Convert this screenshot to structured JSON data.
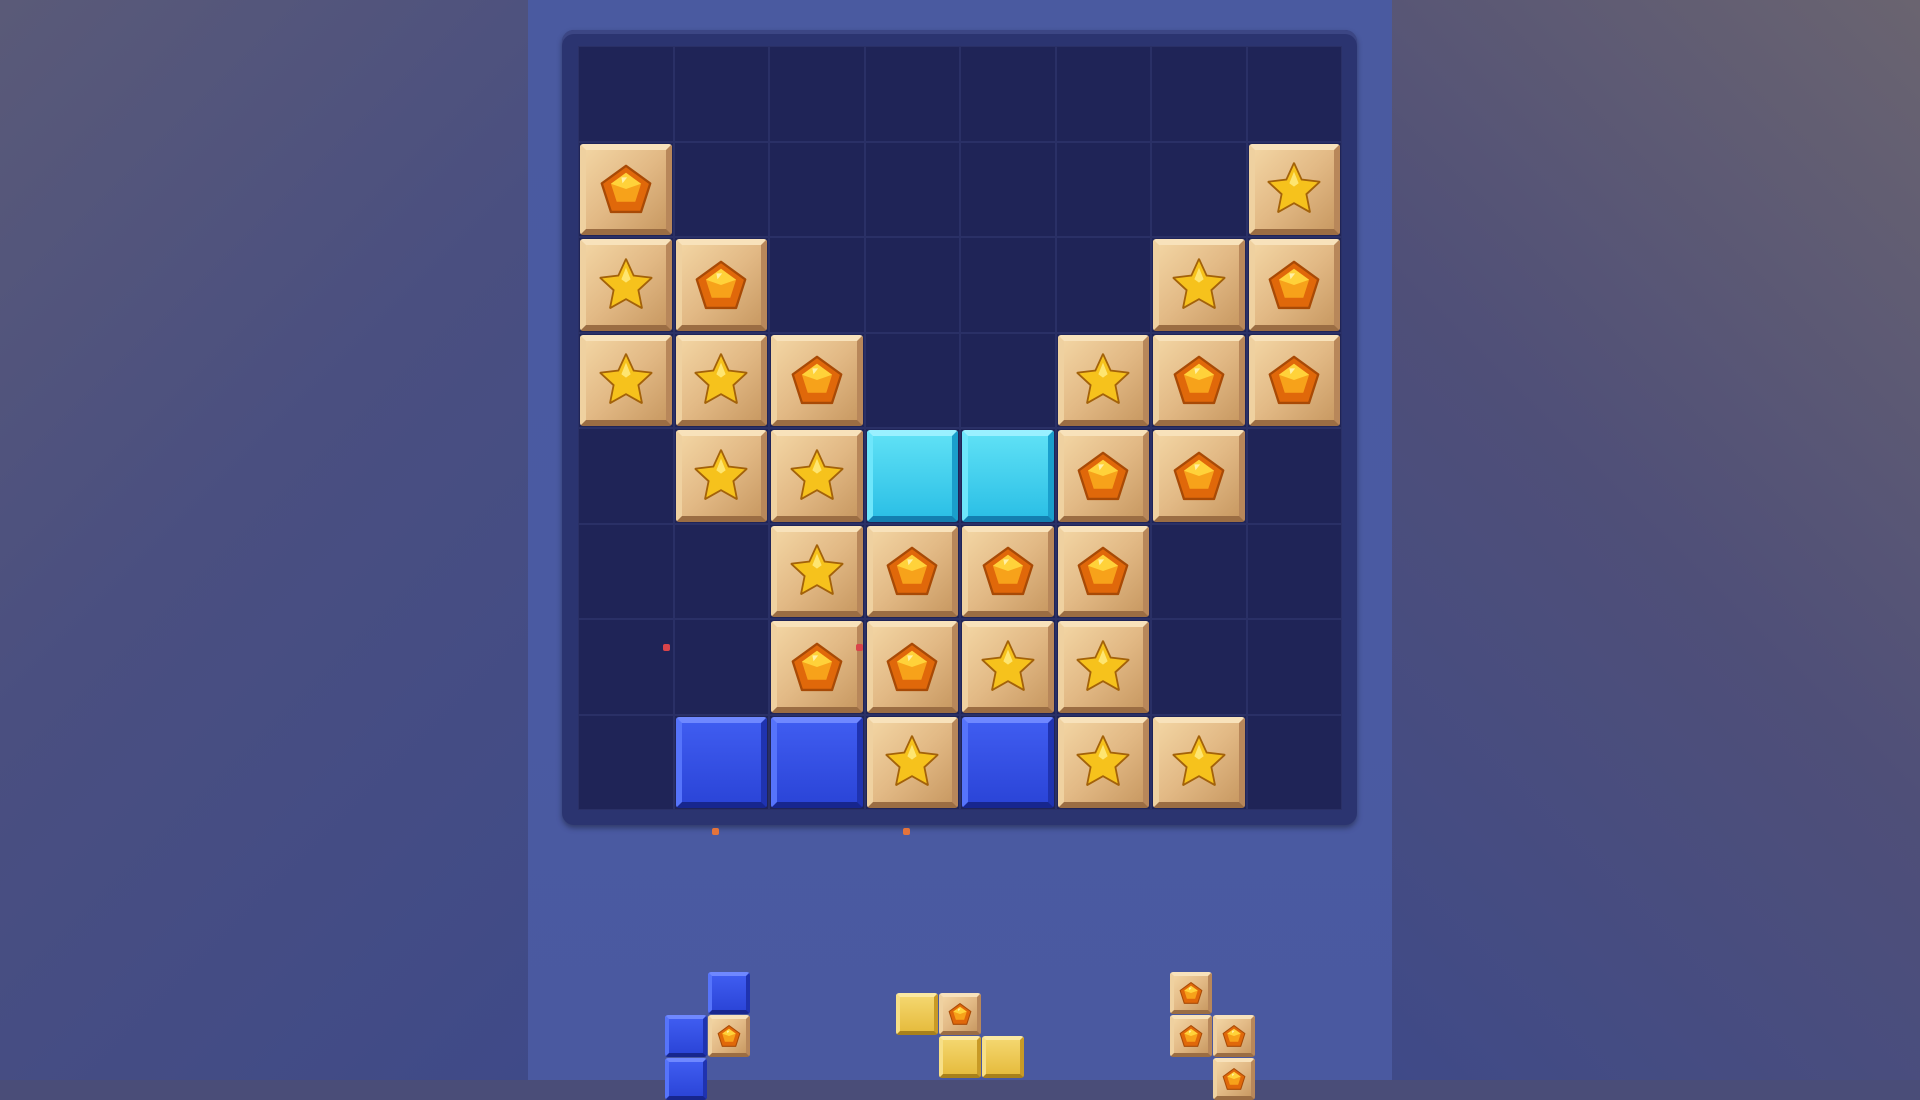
{
  "game": {
    "title": "",
    "board": {
      "rows": 8,
      "cols": 8,
      "cells": [
        [
          "",
          "",
          "",
          "",
          "",
          "",
          "",
          ""
        ],
        [
          "wood-pentagon",
          "",
          "",
          "",
          "",
          "",
          "",
          "wood-star"
        ],
        [
          "wood-star",
          "wood-pentagon",
          "",
          "",
          "",
          "",
          "wood-star",
          "wood-pentagon"
        ],
        [
          "wood-star",
          "wood-star",
          "wood-pentagon",
          "",
          "",
          "wood-star",
          "wood-pentagon",
          "wood-pentagon"
        ],
        [
          "",
          "wood-star",
          "wood-star",
          "cyan",
          "cyan",
          "wood-pentagon",
          "wood-pentagon",
          ""
        ],
        [
          "",
          "",
          "wood-star",
          "wood-pentagon",
          "wood-pentagon",
          "wood-pentagon",
          "",
          ""
        ],
        [
          "",
          "",
          "wood-pentagon",
          "wood-pentagon",
          "wood-star",
          "wood-star",
          "",
          ""
        ],
        [
          "",
          "blue",
          "blue",
          "wood-star",
          "blue",
          "wood-star",
          "wood-star",
          ""
        ]
      ]
    },
    "tray": [
      {
        "name": "tray-piece-blue-s",
        "tiles": [
          "blue",
          "blue",
          "wood-pentagon",
          "blue"
        ]
      },
      {
        "name": "tray-piece-yellow-z",
        "tiles": [
          "yellow",
          "wood-pentagon",
          "yellow",
          "yellow"
        ]
      },
      {
        "name": "tray-piece-wood-t",
        "tiles": [
          "wood-pentagon",
          "wood-pentagon",
          "wood-pentagon",
          "wood-pentagon"
        ]
      }
    ],
    "colors": {
      "board_bg": "#1f2457",
      "frame": "#2b3470",
      "panel": "#4a5aa0",
      "wood": "#e2b985",
      "cyan": "#2cc0e6",
      "blue": "#2b45d8",
      "gem_orange": "#f08a12",
      "star_yellow": "#f6c21c"
    },
    "icons": {
      "pentagon": "pentagon-gem-icon",
      "star": "star-gem-icon"
    }
  }
}
